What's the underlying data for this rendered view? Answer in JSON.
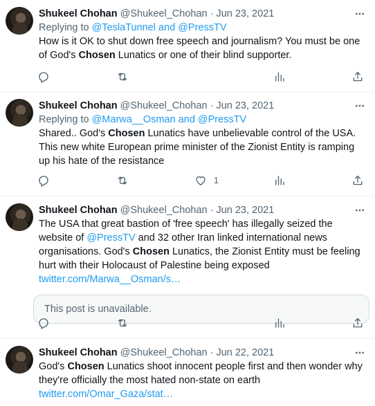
{
  "tweets": [
    {
      "name": "Shukeel Chohan",
      "handle": "@Shukeel_Chohan",
      "dot": "·",
      "date": "Jun 23, 2021",
      "reply_prefix": "Replying to ",
      "reply_users": "@TeslaTunnel and @PressTV",
      "text_parts": [
        "How is it OK to shut down free speech and journalism? You must be one of God's ",
        "Chosen",
        " Lunatics or one of their blind supporter."
      ],
      "likes": ""
    },
    {
      "name": "Shukeel Chohan",
      "handle": "@Shukeel_Chohan",
      "dot": "·",
      "date": "Jun 23, 2021",
      "reply_prefix": "Replying to ",
      "reply_users": "@Marwa__Osman and @PressTV",
      "text_parts": [
        "Shared.. God's ",
        "Chosen",
        " Lunatics have unbelievable control of the USA. This new white European prime minister of the Zionist Entity is ramping up his hate of the resistance"
      ],
      "likes": "1"
    },
    {
      "name": "Shukeel Chohan",
      "handle": "@Shukeel_Chohan",
      "dot": "·",
      "date": "Jun 23, 2021",
      "text_a": "The USA that great bastion of 'free speech' has illegally seized the website of ",
      "mention": "@PressTV",
      "text_b": " and 32 other Iran linked international news organisations. God's ",
      "bold": "Chosen",
      "text_c": " Lunatics, the Zionist Entity  must be feeling hurt with their Holocaust of Palestine being exposed ",
      "link": "twitter.com/Marwa__Osman/s…",
      "unavailable": "This post is unavailable.",
      "likes": ""
    },
    {
      "name": "Shukeel Chohan",
      "handle": "@Shukeel_Chohan",
      "dot": "·",
      "date": "Jun 22, 2021",
      "text_a": "God's ",
      "bold": "Chosen",
      "text_c": " Lunatics shoot innocent people first and then wonder why they're officially the most hated non-state on earth",
      "link": "twitter.com/Omar_Gaza/stat…"
    }
  ]
}
